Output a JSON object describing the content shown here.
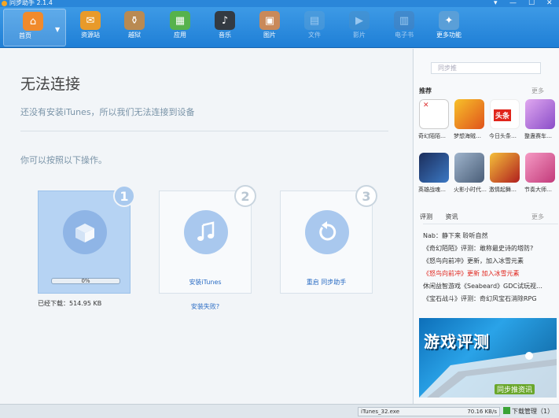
{
  "window": {
    "title": "同步助手 2.1.4",
    "controls": [
      "▾",
      "—",
      "☐",
      "✕"
    ]
  },
  "toolbar": {
    "items": [
      {
        "label": "首页",
        "icon": "home-icon",
        "glyph": "⌂",
        "color": "#f08a2c",
        "active": true
      },
      {
        "label": "资源站",
        "icon": "store-bag-icon",
        "glyph": "✉",
        "color": "#e89a2a"
      },
      {
        "label": "越狱",
        "icon": "jailbreak-jar-icon",
        "glyph": "⚱",
        "color": "#b98a52"
      },
      {
        "label": "应用",
        "icon": "apps-grid-icon",
        "glyph": "▦",
        "color": "#56b24c"
      },
      {
        "label": "音乐",
        "icon": "music-note-icon",
        "glyph": "♪",
        "color": "#333a42"
      },
      {
        "label": "图片",
        "icon": "picture-icon",
        "glyph": "▣",
        "color": "#c9895a"
      },
      {
        "label": "文件",
        "icon": "file-folder-icon",
        "glyph": "▤",
        "color": "#5aa0d8",
        "dim": true
      },
      {
        "label": "影片",
        "icon": "movie-icon",
        "glyph": "▶",
        "color": "#4a90c8",
        "dim": true
      },
      {
        "label": "电子书",
        "icon": "ebook-icon",
        "glyph": "▥",
        "color": "#4a7fb8",
        "dim": true
      },
      {
        "label": "更多功能",
        "icon": "tools-icon",
        "glyph": "✦",
        "color": "#5a9fd8"
      }
    ]
  },
  "main": {
    "heading": "无法连接",
    "subtitle": "还没有安装iTunes，所以我们无法连接到设备",
    "hint": "你可以按照以下操作。",
    "steps": [
      {
        "num": "1",
        "icon": "package-box-icon",
        "progress_text": "0%",
        "progress_value": 0
      },
      {
        "num": "2",
        "icon": "itunes-note-icon",
        "link": "安装iTunes"
      },
      {
        "num": "3",
        "icon": "restart-arrow-icon",
        "link": "重启 同步助手"
      }
    ],
    "downloaded": "已经下载：514.95 KB",
    "install_failed": "安装失败?"
  },
  "sidebar": {
    "search_placeholder": "同步推",
    "recommend_title": "推荐",
    "more": "更多",
    "apps": [
      {
        "label": "奇幻陌陌…",
        "icon": "broken-image-icon",
        "color": "#ffffff"
      },
      {
        "label": "梦想海贼…",
        "icon": "pirate-game-icon",
        "color": "#e0531b"
      },
      {
        "label": "今日头条…",
        "icon": "toutiao-icon",
        "color": "#e0251b"
      },
      {
        "label": "整蛊赛车…",
        "icon": "race-game-icon",
        "color": "#b874d8"
      },
      {
        "label": "英雄战魂…",
        "icon": "hero-game-icon",
        "color": "#2f4c8f"
      },
      {
        "label": "火影小时代…",
        "icon": "ninja-game-icon",
        "color": "#6a86a8"
      },
      {
        "label": "激情起舞…",
        "icon": "dance-game-icon",
        "color": "#d03a2a"
      },
      {
        "label": "节奏大师…",
        "icon": "rhythm-game-icon",
        "color": "#d84a8a"
      }
    ],
    "news_tabs": [
      "评测",
      "资讯"
    ],
    "news": [
      {
        "text": "Nab：静下来 聆听自然"
      },
      {
        "text": "《奇幻陌陌》评测：敢称最史诗的塔防?"
      },
      {
        "text": "《怒鸟向前冲》更新，加入冰雪元素"
      },
      {
        "text": "《怒鸟向前冲》更新 加入冰雪元素",
        "hot": true
      },
      {
        "text": "休闲益智游戏《Seabeard》GDC试玩视…"
      },
      {
        "text": "《宝石战斗》评测：奇幻风宝石消除RPG"
      }
    ],
    "banner": {
      "title": "游戏评测",
      "footer": "同步推资讯"
    }
  },
  "statusbar": {
    "file": "iTunes_32.exe",
    "speed": "70.16 KB/s",
    "download_manager": "下载管理（1）"
  }
}
